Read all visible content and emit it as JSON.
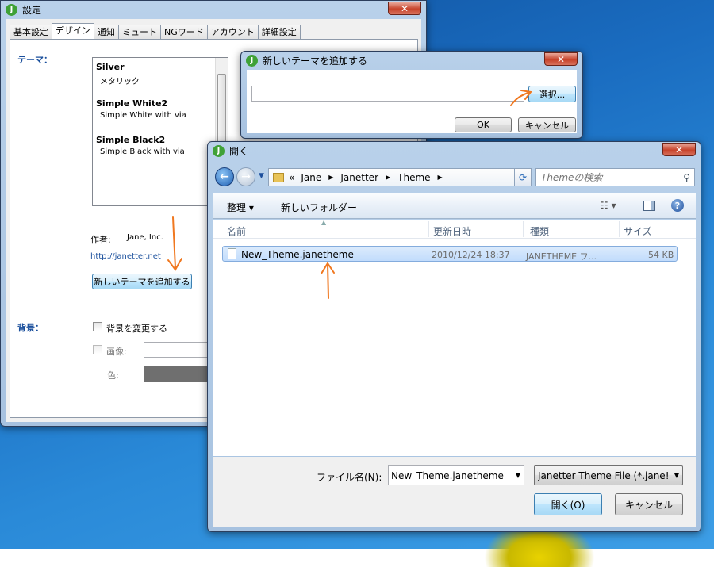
{
  "settings": {
    "title": "設定",
    "close": "✕",
    "tabs": [
      "基本設定",
      "デザイン",
      "通知",
      "ミュート",
      "NGワード",
      "アカウント",
      "詳細設定"
    ],
    "theme_label": "テーマ：",
    "themes": [
      {
        "name": "Silver",
        "desc": "メタリック"
      },
      {
        "name": "Simple White2",
        "desc": "Simple White with via"
      },
      {
        "name": "Simple Black2",
        "desc": "Simple Black with via"
      }
    ],
    "author_label": "作者:",
    "author": "Jane, Inc.",
    "url": "http://janetter.net",
    "add_theme_button": "新しいテーマを追加する",
    "bg_label": "背景：",
    "bg_change": "背景を変更する",
    "image_label": "画像:",
    "color_label": "色:"
  },
  "add_dialog": {
    "title": "新しいテーマを追加する",
    "path_value": "",
    "select_button": "選択...",
    "ok_button": "OK",
    "cancel_button": "キャンセル",
    "close": "✕"
  },
  "open_dialog": {
    "title": "開く",
    "close": "✕",
    "breadcrumb_prefix": "«",
    "breadcrumb": [
      "Jane",
      "Janetter",
      "Theme"
    ],
    "search_placeholder": "Themeの検索",
    "organize": "整理 ▾",
    "new_folder": "新しいフォルダー",
    "columns": [
      "名前",
      "更新日時",
      "種類",
      "サイズ"
    ],
    "files": [
      {
        "name": "New_Theme.janetheme",
        "date": "2010/12/24 18:37",
        "type": "JANETHEME フ...",
        "size": "54 KB"
      }
    ],
    "filename_label": "ファイル名(N):",
    "filename_value": "New_Theme.janetheme",
    "filetype_value": "Janetter Theme File (*.jane!",
    "open_button": "開く(O)",
    "cancel_button": "キャンセル"
  },
  "colors": {
    "accent_arrow": "#f07820",
    "titlebar": "#b9d1ea"
  }
}
